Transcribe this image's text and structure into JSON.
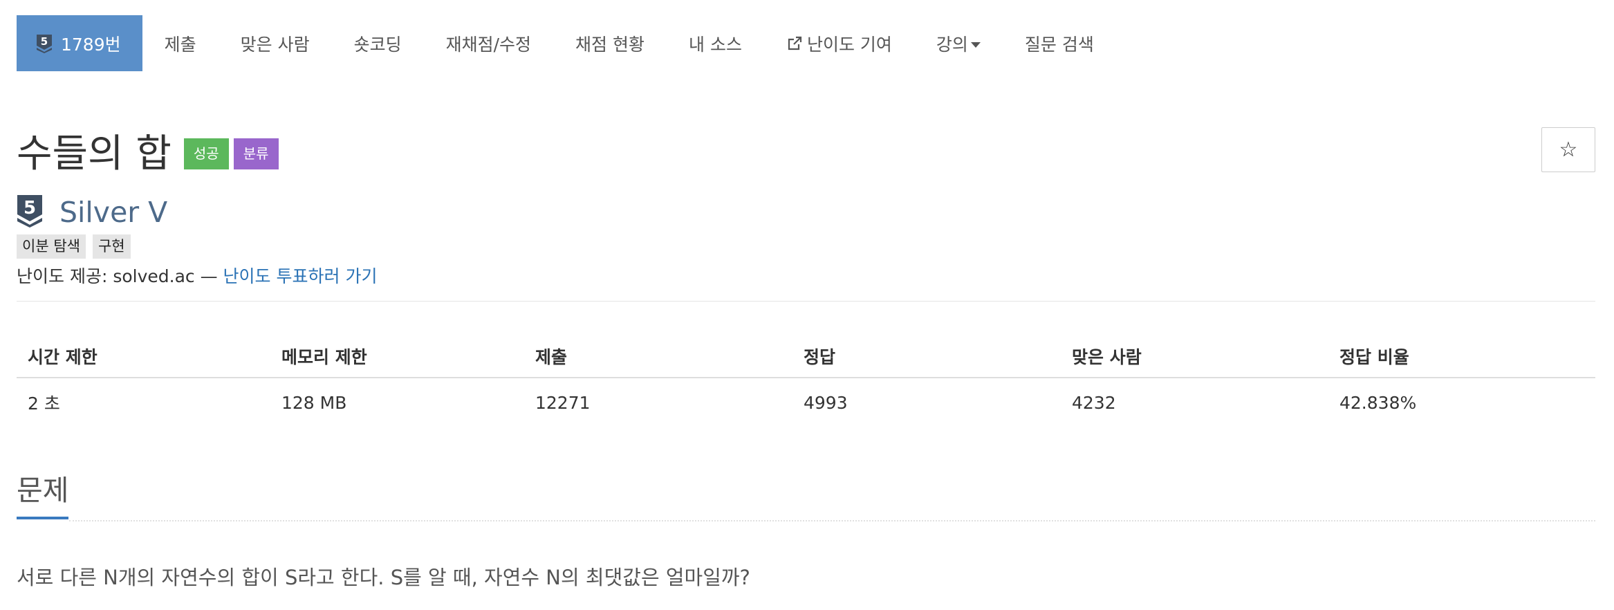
{
  "nav": {
    "problem_id_label": "1789번",
    "tier_badge_number": "5",
    "items": [
      {
        "label": "제출"
      },
      {
        "label": "맞은 사람"
      },
      {
        "label": "숏코딩"
      },
      {
        "label": "재채점/수정"
      },
      {
        "label": "채점 현황"
      },
      {
        "label": "내 소스"
      },
      {
        "label": "난이도 기여",
        "icon": "external-link-icon"
      },
      {
        "label": "강의",
        "icon": "caret-down-icon"
      },
      {
        "label": "질문 검색"
      }
    ],
    "active_color": "#5a8fc9"
  },
  "problem": {
    "title": "수들의 합",
    "labels": {
      "success": "성공",
      "category": "분류"
    },
    "star_icon": "star-icon",
    "star_glyph": "☆"
  },
  "tier": {
    "number": "5",
    "name": "Silver V",
    "color": "#4d6a8a"
  },
  "tags": [
    "이분 탐색",
    "구현"
  ],
  "difficulty": {
    "prefix": "난이도 제공: solved.ac — ",
    "link": "난이도 투표하러 가기"
  },
  "stats": {
    "headers": [
      "시간 제한",
      "메모리 제한",
      "제출",
      "정답",
      "맞은 사람",
      "정답 비율"
    ],
    "values": [
      "2 초",
      "128 MB",
      "12271",
      "4993",
      "4232",
      "42.838%"
    ]
  },
  "section": {
    "title": "문제",
    "text": "서로 다른 N개의 자연수의 합이 S라고 한다. S를 알 때, 자연수 N의 최댓값은 얼마일까?"
  }
}
